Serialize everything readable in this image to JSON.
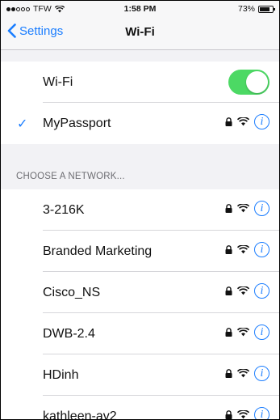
{
  "status_bar": {
    "carrier": "TFW",
    "time": "1:58 PM",
    "battery": "73%",
    "battery_level": 0.73
  },
  "nav": {
    "back_label": "Settings",
    "title": "Wi-Fi"
  },
  "wifi_toggle": {
    "label": "Wi-Fi",
    "on": true
  },
  "connected": {
    "name": "MyPassport"
  },
  "section_header": "CHOOSE A NETWORK...",
  "networks": [
    {
      "name": "3-216K"
    },
    {
      "name": "Branded Marketing"
    },
    {
      "name": "Cisco_NS"
    },
    {
      "name": "DWB-2.4"
    },
    {
      "name": "HDinh"
    },
    {
      "name": "kathleen-av2"
    }
  ],
  "colors": {
    "accent": "#1a7dff",
    "toggle_on": "#4cd964",
    "background": "#f2f2f5"
  }
}
